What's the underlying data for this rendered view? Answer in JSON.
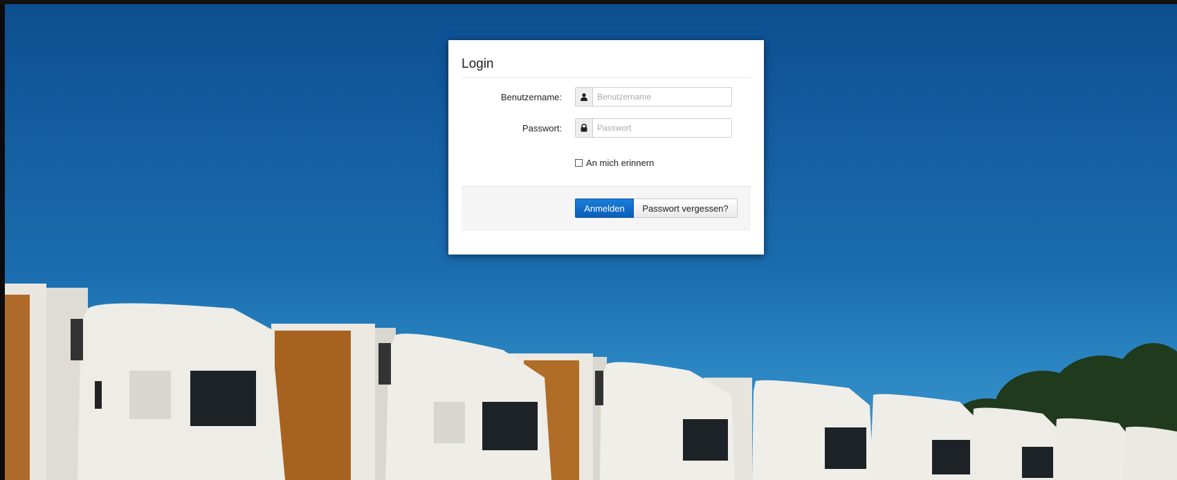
{
  "login": {
    "title": "Login",
    "username_label": "Benutzername:",
    "username_placeholder": "Benutzername",
    "username_value": "",
    "username_icon": "user-icon",
    "password_label": "Passwort:",
    "password_placeholder": "Passwort",
    "password_value": "",
    "password_icon": "lock-icon",
    "remember_label": "An mich erinnern",
    "remember_checked": false,
    "submit_label": "Anmelden",
    "forgot_label": "Passwort vergessen?"
  },
  "colors": {
    "primary_button": "#0c6ed0",
    "sky": "#1a6cae"
  }
}
